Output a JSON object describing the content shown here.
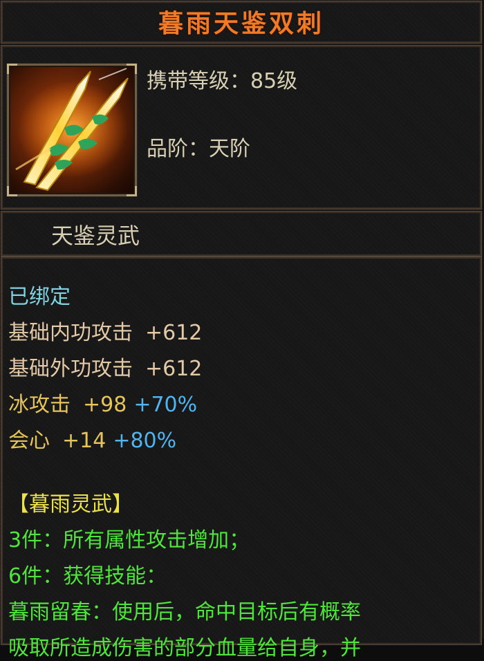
{
  "item": {
    "name": "暮雨天鉴双刺",
    "icon": "twin-dagger-icon"
  },
  "info": {
    "level_label": "携带等级：85级",
    "grade_label": "品阶：天阶"
  },
  "set_title": "天鉴灵武",
  "stats": {
    "bound": "已绑定",
    "inner_attack": {
      "label": "基础内功攻击",
      "value": "+612"
    },
    "outer_attack": {
      "label": "基础外功攻击",
      "value": "+612"
    },
    "ice_attack": {
      "label": "冰攻击",
      "value": "+98",
      "pct": "+70%"
    },
    "crit": {
      "label": "会心",
      "value": "+14",
      "pct": "+80%"
    }
  },
  "set_bonus": {
    "header": "【暮雨灵武】",
    "three_piece": "3件：所有属性攻击增加；",
    "six_piece": "6件：获得技能：",
    "skill_desc": "暮雨留春：使用后，命中目标后有概率",
    "skill_desc_cont": "吸取所造成伤害的部分血量给自身，并"
  },
  "colors": {
    "title": "#f07a26",
    "bound": "#7fd3e3",
    "base_stat": "#e4c9a6",
    "element_stat": "#e6c45a",
    "percent": "#4fb4f0",
    "set_bonus": "#4ee63a"
  }
}
